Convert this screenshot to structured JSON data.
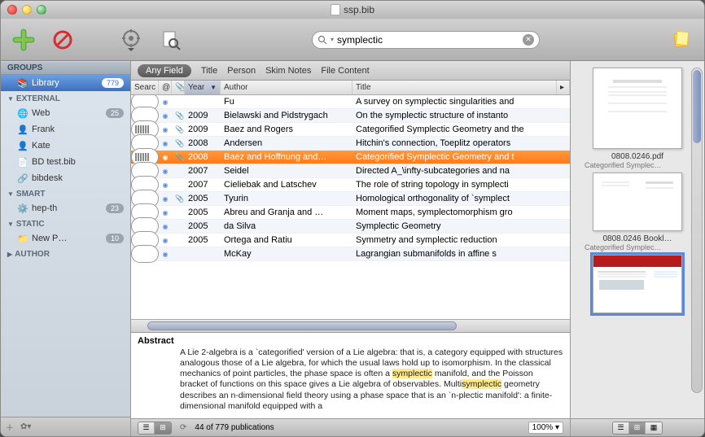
{
  "window": {
    "title": "ssp.bib"
  },
  "search": {
    "value": "symplectic"
  },
  "sidebar": {
    "groups_header": "GROUPS",
    "library": {
      "label": "Library",
      "count": "779"
    },
    "external_header": "EXTERNAL",
    "external": [
      {
        "label": "Web",
        "count": "25",
        "icon": "globe"
      },
      {
        "label": "Frank",
        "icon": "person"
      },
      {
        "label": "Kate",
        "icon": "person"
      },
      {
        "label": "BD test.bib",
        "icon": "doc"
      },
      {
        "label": "bibdesk",
        "icon": "link"
      }
    ],
    "smart_header": "SMART",
    "smart": [
      {
        "label": "hep-th",
        "count": "23",
        "icon": "gear-folder"
      }
    ],
    "static_header": "STATIC",
    "static": [
      {
        "label": "New P…",
        "count": "10",
        "icon": "folder"
      }
    ],
    "author_header": "AUTHOR"
  },
  "filters": {
    "any": "Any Field",
    "title": "Title",
    "person": "Person",
    "skim": "Skim Notes",
    "file": "File Content"
  },
  "columns": {
    "search": "Searc",
    "at": "@",
    "clip": "📎",
    "year": "Year",
    "author": "Author",
    "title": "Title"
  },
  "rows": [
    {
      "rel": "",
      "at": "●",
      "clip": "",
      "year": "",
      "author": "Fu",
      "title": "A survey on symplectic singularities and"
    },
    {
      "rel": "",
      "at": "●",
      "clip": "📎",
      "year": "2009",
      "author": "Bielawski and Pidstrygach",
      "title": "On the symplectic structure of instanto"
    },
    {
      "rel": "high",
      "at": "●",
      "clip": "📎",
      "year": "2009",
      "author": "Baez and Rogers",
      "title": "Categorified Symplectic Geometry and the"
    },
    {
      "rel": "",
      "at": "●",
      "clip": "📎",
      "year": "2008",
      "author": "Andersen",
      "title": "Hitchin's connection, Toeplitz operators"
    },
    {
      "rel": "high",
      "at": "●",
      "clip": "📎",
      "year": "2008",
      "author": "Baez and Hoffnung and…",
      "title": "Categorified Symplectic Geometry and t",
      "selected": true
    },
    {
      "rel": "",
      "at": "●",
      "clip": "",
      "year": "2007",
      "author": "Seidel",
      "title": "Directed A_\\infty-subcategories and na"
    },
    {
      "rel": "",
      "at": "●",
      "clip": "",
      "year": "2007",
      "author": "Cieliebak and Latschev",
      "title": "The role of string topology in symplecti"
    },
    {
      "rel": "",
      "at": "●",
      "clip": "📎",
      "year": "2005",
      "author": "Tyurin",
      "title": "Homological orthogonality of `symplect"
    },
    {
      "rel": "",
      "at": "●",
      "clip": "",
      "year": "2005",
      "author": "Abreu and Granja and …",
      "title": "Moment maps, symplectomorphism gro"
    },
    {
      "rel": "",
      "at": "●",
      "clip": "",
      "year": "2005",
      "author": "da Silva",
      "title": "Symplectic Geometry"
    },
    {
      "rel": "",
      "at": "●",
      "clip": "",
      "year": "2005",
      "author": "Ortega and Ratiu",
      "title": "Symmetry and symplectic reduction"
    },
    {
      "rel": "",
      "at": "●",
      "clip": "",
      "year": "",
      "author": "McKay",
      "title": "Lagrangian submanifolds in affine s"
    }
  ],
  "abstract": {
    "heading": "Abstract",
    "pre": "A Lie 2-algebra is a `categorified' version of a Lie algebra: that is, a category equipped with structures analogous those of a Lie algebra, for which the usual laws hold up to isomorphism. In the classical mechanics of point particles, the phase space is often a ",
    "hl1": "symplectic",
    "mid": " manifold, and the Poisson bracket of functions on this space gives a Lie algebra of observables. Multi",
    "hl2": "symplectic",
    "post": " geometry describes an n-dimensional field theory using a phase space that is an `n-plectic manifold': a finite-dimensional manifold equipped with a"
  },
  "status": {
    "text": "44 of 779 publications",
    "zoom": "100%"
  },
  "preview": [
    {
      "name": "0808.0246.pdf",
      "sub": "Categorified Symplec…"
    },
    {
      "name": "0808.0246 Bookl…",
      "sub": "Categorified Symplec…"
    },
    {
      "name": "",
      "sub": ""
    }
  ]
}
